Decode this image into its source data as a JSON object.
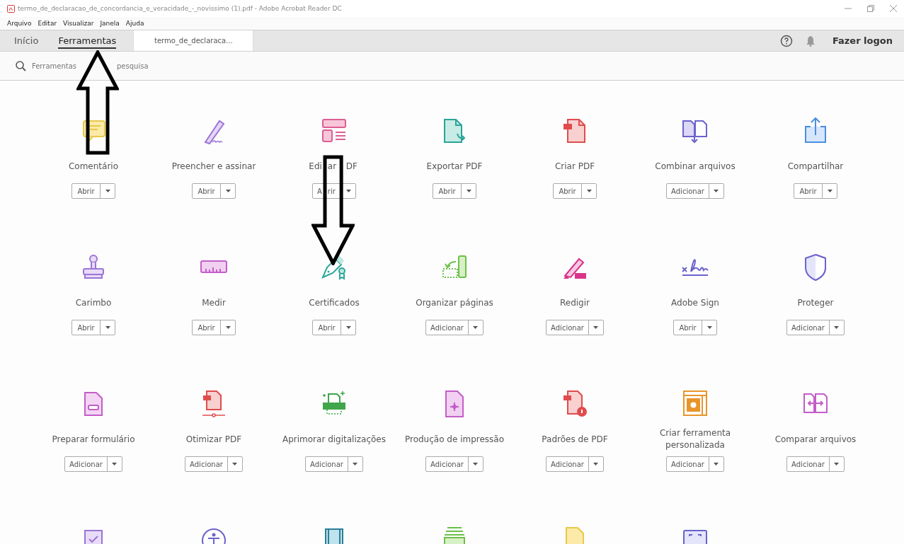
{
  "window": {
    "title": "termo_de_declaracao_de_concordancia_e_veracidade_-_novissimo (1).pdf - Adobe Acrobat Reader DC"
  },
  "menu": [
    "Arquivo",
    "Editar",
    "Visualizar",
    "Janela",
    "Ajuda"
  ],
  "tabs": [
    {
      "label": "Início",
      "selected": false,
      "kind": "nav"
    },
    {
      "label": "Ferramentas",
      "selected": true,
      "kind": "nav"
    },
    {
      "label": "termo_de_declaraca...",
      "selected": false,
      "kind": "document"
    }
  ],
  "sign_in": "Fazer logon",
  "search": {
    "placeholder": "Ferramentas",
    "placeholder_tail": "pesquisa"
  },
  "tools": [
    {
      "kind": "tool",
      "label": "Comentário",
      "button": "Abrir"
    },
    {
      "kind": "tool",
      "label": "Preencher e assinar",
      "button": "Abrir"
    },
    {
      "kind": "covered",
      "label_parts": [
        "Edi",
        "ar",
        "DF"
      ],
      "button_parts": [
        "A",
        "rir"
      ]
    },
    {
      "kind": "tool",
      "label": "Exportar PDF",
      "button": "Abrir"
    },
    {
      "kind": "tool",
      "label": "Criar PDF",
      "button": "Abrir"
    },
    {
      "kind": "tool",
      "label": "Combinar arquivos",
      "button": "Adicionar"
    },
    {
      "kind": "tool",
      "label": "Compartilhar",
      "button": "Abrir"
    },
    {
      "kind": "tool",
      "label": "Carimbo",
      "button": "Abrir"
    },
    {
      "kind": "tool",
      "label": "Medir",
      "button": "Abrir"
    },
    {
      "kind": "tool",
      "label": "Certificados",
      "button": "Abrir"
    },
    {
      "kind": "tool",
      "label": "Organizar páginas",
      "button": "Adicionar"
    },
    {
      "kind": "tool",
      "label": "Redigir",
      "button": "Adicionar"
    },
    {
      "kind": "tool",
      "label": "Adobe Sign",
      "button": "Abrir"
    },
    {
      "kind": "tool",
      "label": "Proteger",
      "button": "Adicionar"
    },
    {
      "kind": "tool",
      "label": "Preparar formulário",
      "button": "Adicionar"
    },
    {
      "kind": "tool",
      "label": "Otimizar PDF",
      "button": "Adicionar"
    },
    {
      "kind": "tool",
      "label": "Aprimorar digitalizações",
      "button": "Adicionar"
    },
    {
      "kind": "tool",
      "label": "Produção de impressão",
      "button": "Adicionar"
    },
    {
      "kind": "tool",
      "label": "Padrões de PDF",
      "button": "Adicionar"
    },
    {
      "kind": "tool",
      "label": "Criar ferramenta personalizada",
      "button": "Adicionar"
    },
    {
      "kind": "tool",
      "label": "Comparar arquivos",
      "button": "Adicionar"
    },
    {
      "kind": "cut"
    },
    {
      "kind": "cut"
    },
    {
      "kind": "cut"
    },
    {
      "kind": "cut"
    },
    {
      "kind": "cut"
    },
    {
      "kind": "cut"
    }
  ],
  "annotations": [
    {
      "kind": "up"
    },
    {
      "kind": "down"
    }
  ]
}
